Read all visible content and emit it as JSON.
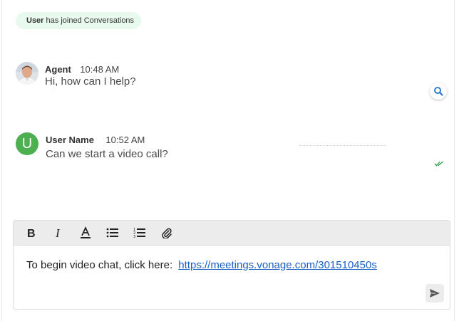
{
  "system_notice": {
    "user": "User",
    "text": "has joined Conversations"
  },
  "messages": [
    {
      "sender": "Agent",
      "time": "10:48 AM",
      "text": "Hi, how can I help?",
      "avatar": "agent-photo"
    },
    {
      "sender": "User Name",
      "time": "10:52 AM",
      "text": "Can we start a video call?",
      "avatar_initial": "U",
      "status_icon": "double-check-icon"
    }
  ],
  "toolbar": {
    "items": [
      "bold-icon",
      "italic-icon",
      "font-color-icon",
      "bullet-list-icon",
      "numbered-list-icon",
      "attachment-icon"
    ]
  },
  "composer": {
    "draft_text": "To begin video chat, click here:",
    "link_text": "https://meetings.vonage.com/301510450s"
  },
  "colors": {
    "notice_bg": "#e8faee",
    "user_avatar": "#4caf50",
    "link": "#1a5fc4",
    "search_icon": "#1f6fd1",
    "read_check": "#2e9e4a"
  }
}
